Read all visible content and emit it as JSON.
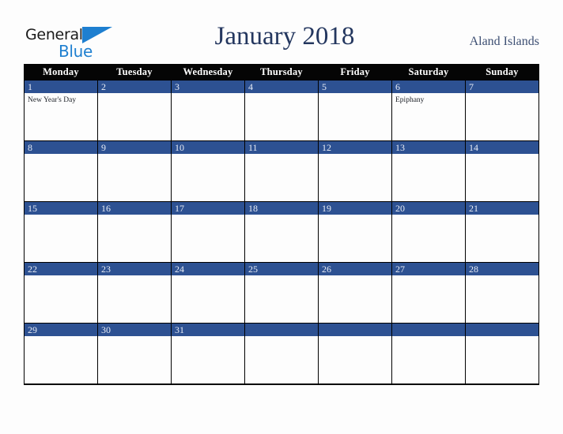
{
  "brand": {
    "name_part1": "General",
    "name_part2": "Blue",
    "color_dark": "#1a1a1a",
    "color_blue": "#1e7fd0"
  },
  "header": {
    "title": "January 2018",
    "region": "Aland Islands",
    "title_color": "#24375f",
    "region_color": "#3d4f73"
  },
  "calendar": {
    "month": "January",
    "year": "2018",
    "week_start": "Monday",
    "header_bg": "#050505",
    "date_bar_bg": "#2d5192",
    "date_text_color": "#e8ecf5",
    "cell_bg": "#fdfdfd",
    "grid_color": "#000000",
    "day_headers": [
      "Monday",
      "Tuesday",
      "Wednesday",
      "Thursday",
      "Friday",
      "Saturday",
      "Sunday"
    ],
    "weeks": [
      [
        {
          "date": "1",
          "event": "New Year's Day"
        },
        {
          "date": "2",
          "event": ""
        },
        {
          "date": "3",
          "event": ""
        },
        {
          "date": "4",
          "event": ""
        },
        {
          "date": "5",
          "event": ""
        },
        {
          "date": "6",
          "event": "Epiphany"
        },
        {
          "date": "7",
          "event": ""
        }
      ],
      [
        {
          "date": "8",
          "event": ""
        },
        {
          "date": "9",
          "event": ""
        },
        {
          "date": "10",
          "event": ""
        },
        {
          "date": "11",
          "event": ""
        },
        {
          "date": "12",
          "event": ""
        },
        {
          "date": "13",
          "event": ""
        },
        {
          "date": "14",
          "event": ""
        }
      ],
      [
        {
          "date": "15",
          "event": ""
        },
        {
          "date": "16",
          "event": ""
        },
        {
          "date": "17",
          "event": ""
        },
        {
          "date": "18",
          "event": ""
        },
        {
          "date": "19",
          "event": ""
        },
        {
          "date": "20",
          "event": ""
        },
        {
          "date": "21",
          "event": ""
        }
      ],
      [
        {
          "date": "22",
          "event": ""
        },
        {
          "date": "23",
          "event": ""
        },
        {
          "date": "24",
          "event": ""
        },
        {
          "date": "25",
          "event": ""
        },
        {
          "date": "26",
          "event": ""
        },
        {
          "date": "27",
          "event": ""
        },
        {
          "date": "28",
          "event": ""
        }
      ],
      [
        {
          "date": "29",
          "event": ""
        },
        {
          "date": "30",
          "event": ""
        },
        {
          "date": "31",
          "event": ""
        },
        {
          "date": "",
          "event": ""
        },
        {
          "date": "",
          "event": ""
        },
        {
          "date": "",
          "event": ""
        },
        {
          "date": "",
          "event": ""
        }
      ]
    ]
  }
}
